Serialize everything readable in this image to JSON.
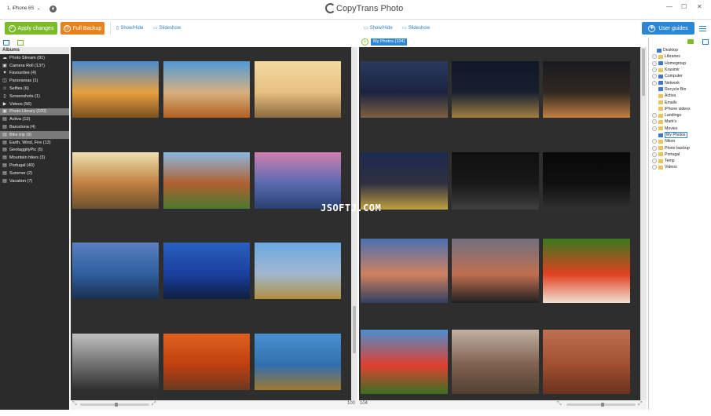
{
  "window": {
    "device_selector": "1. iPhone 6S",
    "app_title": "CopyTrans Photo",
    "minimize": "—",
    "maximize": "☐",
    "close": "✕"
  },
  "toolbar": {
    "apply_label": "Apply changes",
    "backup_label": "Full Backup",
    "left_showhide": "Show/Hide",
    "left_slideshow": "Slideshow",
    "right_showhide": "Show/Hide",
    "right_slideshow": "Slideshow",
    "guides_label": "User guides"
  },
  "sidebar": {
    "header": "Albums",
    "albums": [
      {
        "label": "Photo Stream (81)",
        "icon": "cloud-icon",
        "glyph": "☁",
        "selected": false
      },
      {
        "label": "Camera Roll (137)",
        "icon": "camera-icon",
        "glyph": "▣",
        "selected": false
      },
      {
        "label": "Favourites (4)",
        "icon": "heart-icon",
        "glyph": "♥",
        "selected": false
      },
      {
        "label": "Panoramas (1)",
        "icon": "panorama-icon",
        "glyph": "◫",
        "selected": false
      },
      {
        "label": "Selfies (6)",
        "icon": "person-icon",
        "glyph": "☺",
        "selected": false
      },
      {
        "label": "Screenshots (1)",
        "icon": "phone-icon",
        "glyph": "▯",
        "selected": false
      },
      {
        "label": "Videos (56)",
        "icon": "video-icon",
        "glyph": "▶",
        "selected": false
      },
      {
        "label": "Photo Library (100)",
        "icon": "camera-icon",
        "glyph": "▣",
        "selected": true
      },
      {
        "label": "Activa (13)",
        "icon": "album-icon",
        "glyph": "▤",
        "selected": false
      },
      {
        "label": "Barcelona (4)",
        "icon": "album-icon",
        "glyph": "▤",
        "selected": false
      },
      {
        "label": "Bike trip (9)",
        "icon": "album-icon",
        "glyph": "▤",
        "selected": true
      },
      {
        "label": "Earth, Wind, Fire (13)",
        "icon": "album-icon",
        "glyph": "▤",
        "selected": false
      },
      {
        "label": "GeotaggityPic (5)",
        "icon": "album-icon",
        "glyph": "▤",
        "selected": false
      },
      {
        "label": "Mountain hikes (3)",
        "icon": "album-icon",
        "glyph": "▤",
        "selected": false
      },
      {
        "label": "Portugal (40)",
        "icon": "album-icon",
        "glyph": "▤",
        "selected": false
      },
      {
        "label": "Summer (2)",
        "icon": "album-icon",
        "glyph": "▤",
        "selected": false
      },
      {
        "label": "Vacation (7)",
        "icon": "album-icon",
        "glyph": "▤",
        "selected": false
      }
    ]
  },
  "left_pane": {
    "count": "100",
    "photos": [
      {
        "name": "autumn-tree-house",
        "colors": [
          "#4a8bd0",
          "#e8a040",
          "#7a5020"
        ]
      },
      {
        "name": "villa-autumn",
        "colors": [
          "#4e9ad8",
          "#d8b080",
          "#b06020"
        ]
      },
      {
        "name": "building-sunset",
        "colors": [
          "#f3d9a0",
          "#e6c080",
          "#8a6a40"
        ]
      },
      {
        "name": "courtyard-tree",
        "colors": [
          "#f0e0b0",
          "#c08040",
          "#6a5030"
        ]
      },
      {
        "name": "garden-sculpture",
        "colors": [
          "#8ab8e0",
          "#b06030",
          "#4a7a30"
        ]
      },
      {
        "name": "lake-sunset-pink",
        "colors": [
          "#d080b0",
          "#5a6ab0",
          "#2a4070"
        ]
      },
      {
        "name": "car-lake-dusk",
        "colors": [
          "#5a80c0",
          "#3060a0",
          "#1a3050"
        ]
      },
      {
        "name": "car-night-blue",
        "colors": [
          "#2a60c0",
          "#1a40a0",
          "#102040"
        ]
      },
      {
        "name": "lake-vineyard",
        "colors": [
          "#6aa8e0",
          "#a0b8d0",
          "#b09040"
        ]
      },
      {
        "name": "snow-mountains-bw",
        "colors": [
          "#c0c0c0",
          "#707070",
          "#303030"
        ]
      },
      {
        "name": "autumn-path",
        "colors": [
          "#e06020",
          "#c04010",
          "#6a3a20"
        ]
      },
      {
        "name": "lake-vineyard-2",
        "colors": [
          "#4a90d0",
          "#3070b0",
          "#a07830"
        ]
      }
    ]
  },
  "right_pane": {
    "tag": "My Photos (104)",
    "count": "104",
    "photos": [
      {
        "name": "night-lake-city",
        "colors": [
          "#2a3a60",
          "#1a2440",
          "#806040"
        ]
      },
      {
        "name": "night-lakeside-lights",
        "colors": [
          "#101828",
          "#182030",
          "#a08040"
        ]
      },
      {
        "name": "castle-night",
        "colors": [
          "#1a1a20",
          "#302820",
          "#c08040"
        ]
      },
      {
        "name": "castle-lit-night",
        "colors": [
          "#1a2a50",
          "#303040",
          "#c0a040"
        ]
      },
      {
        "name": "moon-lake",
        "colors": [
          "#101010",
          "#181818",
          "#404040"
        ]
      },
      {
        "name": "castle-moonlit",
        "colors": [
          "#080808",
          "#101010",
          "#303030"
        ]
      },
      {
        "name": "pier-sunset",
        "colors": [
          "#4a70b0",
          "#d08060",
          "#304060"
        ]
      },
      {
        "name": "lake-dusk-dark",
        "colors": [
          "#707080",
          "#c07050",
          "#202020"
        ]
      },
      {
        "name": "poppy-field",
        "colors": [
          "#3a7a20",
          "#e04020",
          "#f0e0d0"
        ]
      },
      {
        "name": "tulips-lake",
        "colors": [
          "#4a90d0",
          "#e04030",
          "#3a7020"
        ]
      },
      {
        "name": "old-building-balcony",
        "colors": [
          "#c0b0a0",
          "#806050",
          "#504030"
        ]
      },
      {
        "name": "gothic-building",
        "colors": [
          "#c07050",
          "#a05030",
          "#6a3020"
        ]
      }
    ]
  },
  "tree": {
    "items": [
      {
        "label": "Desktop",
        "indent": 0,
        "expander": false,
        "folder": "blue",
        "selected": false
      },
      {
        "label": "Libraries",
        "indent": 1,
        "expander": true,
        "folder": "yellow",
        "selected": false
      },
      {
        "label": "Homegroup",
        "indent": 1,
        "expander": true,
        "folder": "blue",
        "selected": false
      },
      {
        "label": "Krasimir",
        "indent": 1,
        "expander": true,
        "folder": "yellow",
        "selected": false
      },
      {
        "label": "Computer",
        "indent": 1,
        "expander": true,
        "folder": "blue",
        "selected": false
      },
      {
        "label": "Network",
        "indent": 1,
        "expander": true,
        "folder": "blue",
        "selected": false
      },
      {
        "label": "Recycle Bin",
        "indent": 1,
        "expander": false,
        "folder": "blue",
        "selected": false
      },
      {
        "label": "Activa",
        "indent": 1,
        "expander": false,
        "folder": "yellow",
        "selected": false
      },
      {
        "label": "Emails",
        "indent": 1,
        "expander": false,
        "folder": "yellow",
        "selected": false
      },
      {
        "label": "iPhone videos",
        "indent": 1,
        "expander": false,
        "folder": "yellow",
        "selected": false
      },
      {
        "label": "Landings",
        "indent": 1,
        "expander": true,
        "folder": "yellow",
        "selected": false
      },
      {
        "label": "Mark's",
        "indent": 1,
        "expander": true,
        "folder": "yellow",
        "selected": false
      },
      {
        "label": "Movies",
        "indent": 1,
        "expander": true,
        "folder": "yellow",
        "selected": false
      },
      {
        "label": "My Photos",
        "indent": 1,
        "expander": false,
        "folder": "blue",
        "selected": true
      },
      {
        "label": "Nikon",
        "indent": 1,
        "expander": true,
        "folder": "yellow",
        "selected": false
      },
      {
        "label": "Photo backup",
        "indent": 1,
        "expander": true,
        "folder": "yellow",
        "selected": false
      },
      {
        "label": "Portugal",
        "indent": 1,
        "expander": true,
        "folder": "yellow",
        "selected": false
      },
      {
        "label": "Temp",
        "indent": 1,
        "expander": true,
        "folder": "yellow",
        "selected": false
      },
      {
        "label": "Videos",
        "indent": 1,
        "expander": true,
        "folder": "yellow",
        "selected": false
      }
    ]
  },
  "watermark": "JSOFTJ.COM",
  "colors": {
    "apply_green": "#7dbb2b",
    "backup_orange": "#e8821e",
    "accent_blue": "#2d87d4",
    "pane_dark": "#2e2e2e"
  }
}
